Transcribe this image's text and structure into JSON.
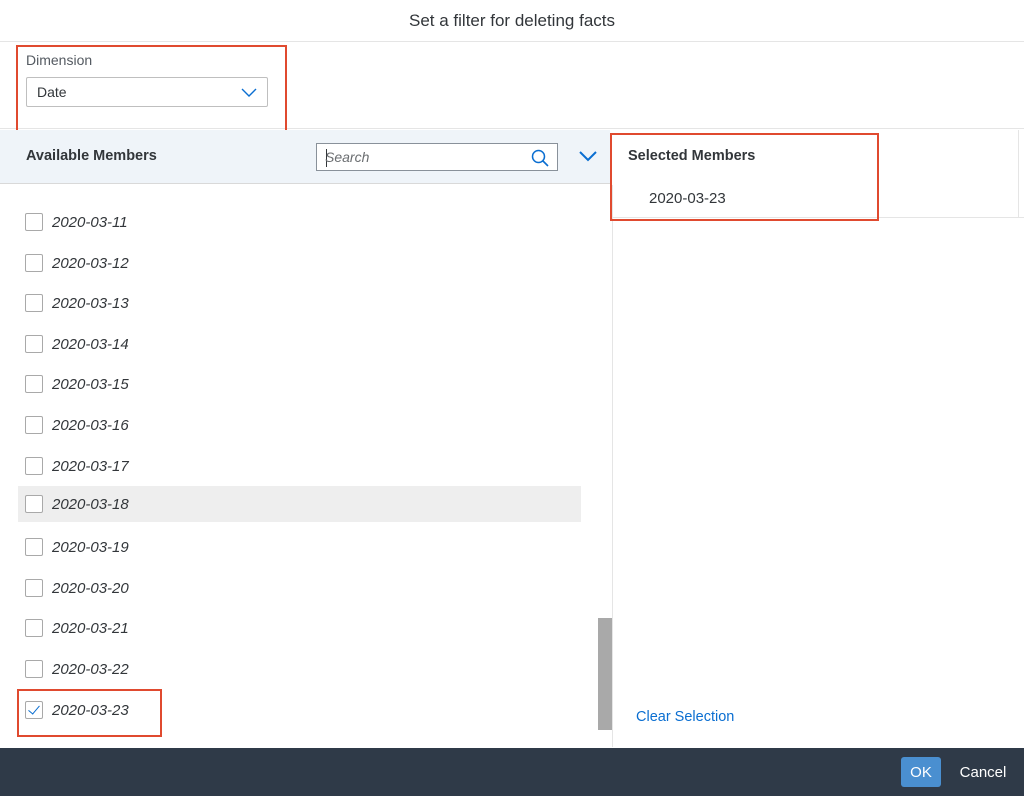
{
  "dialog": {
    "title": "Set a filter for deleting facts"
  },
  "dimension": {
    "label": "Dimension",
    "selected_value": "Date"
  },
  "available_members": {
    "title": "Available Members",
    "search_placeholder": "Search",
    "items": [
      {
        "label": "2020-03-11",
        "checked": false
      },
      {
        "label": "2020-03-12",
        "checked": false
      },
      {
        "label": "2020-03-13",
        "checked": false
      },
      {
        "label": "2020-03-14",
        "checked": false
      },
      {
        "label": "2020-03-15",
        "checked": false
      },
      {
        "label": "2020-03-16",
        "checked": false
      },
      {
        "label": "2020-03-17",
        "checked": false
      },
      {
        "label": "2020-03-18",
        "checked": false
      },
      {
        "label": "2020-03-19",
        "checked": false
      },
      {
        "label": "2020-03-20",
        "checked": false
      },
      {
        "label": "2020-03-21",
        "checked": false
      },
      {
        "label": "2020-03-22",
        "checked": false
      },
      {
        "label": "2020-03-23",
        "checked": true
      }
    ]
  },
  "selected_members": {
    "title": "Selected Members",
    "items": [
      "2020-03-23"
    ],
    "clear_label": "Clear Selection"
  },
  "footer": {
    "ok_label": "OK",
    "cancel_label": "Cancel"
  },
  "colors": {
    "accent": "#0a6ed1",
    "highlight": "#e04a2f",
    "footer_bg": "#2f3a48",
    "ok_button": "#4a8fd0"
  },
  "icons": {
    "dimension_dropdown": "chevron-down-icon",
    "search": "search-icon",
    "expand": "chevron-down-icon"
  }
}
